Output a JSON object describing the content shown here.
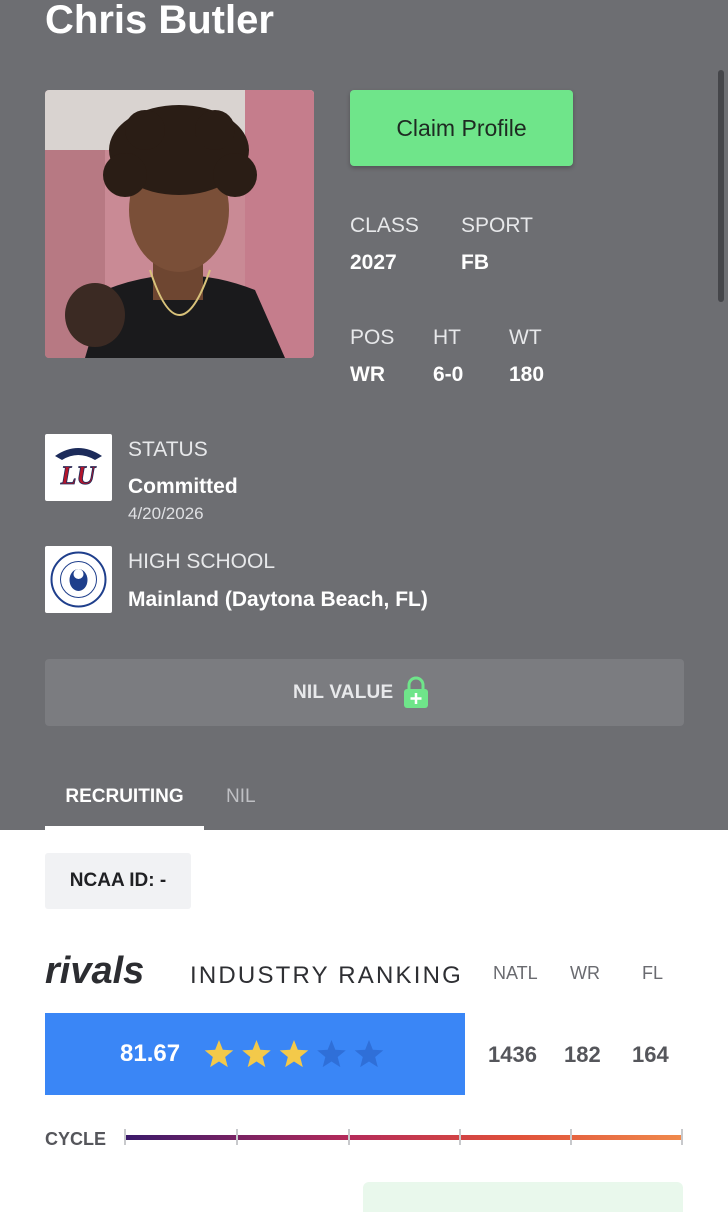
{
  "player": {
    "name": "Chris Butler"
  },
  "actions": {
    "claim_label": "Claim Profile"
  },
  "stats": {
    "class_label": "CLASS",
    "class_value": "2027",
    "sport_label": "SPORT",
    "sport_value": "FB",
    "pos_label": "POS",
    "pos_value": "WR",
    "ht_label": "HT",
    "ht_value": "6-0",
    "wt_label": "WT",
    "wt_value": "180"
  },
  "status": {
    "label": "STATUS",
    "value": "Committed",
    "date": "4/20/2026",
    "logo_icon": "liberty-university-logo",
    "logo_text": "LU"
  },
  "high_school": {
    "label": "HIGH SCHOOL",
    "value": "Mainland (Daytona Beach, FL)",
    "logo_icon": "mainland-high-school-seal"
  },
  "nil": {
    "label": "NIL VALUE",
    "icon": "lock-plus-icon"
  },
  "tabs": [
    {
      "label": "RECRUITING",
      "active": true
    },
    {
      "label": "NIL",
      "active": false
    }
  ],
  "ncaa": {
    "label": "NCAA ID:  -"
  },
  "ranking": {
    "brand": "rivals",
    "title": "INDUSTRY RANKING",
    "columns": [
      "NATL",
      "WR",
      "FL"
    ],
    "score": "81.67",
    "stars_filled": 3,
    "stars_total": 5,
    "values": [
      "1436",
      "182",
      "164"
    ]
  },
  "cycle": {
    "label": "CYCLE"
  },
  "colors": {
    "header_bg": "#6d6e72",
    "accent_green": "#6fe58a",
    "score_blue": "#3a86f6",
    "star_gold": "#f3c94a",
    "star_empty": "#2f6fd8"
  }
}
